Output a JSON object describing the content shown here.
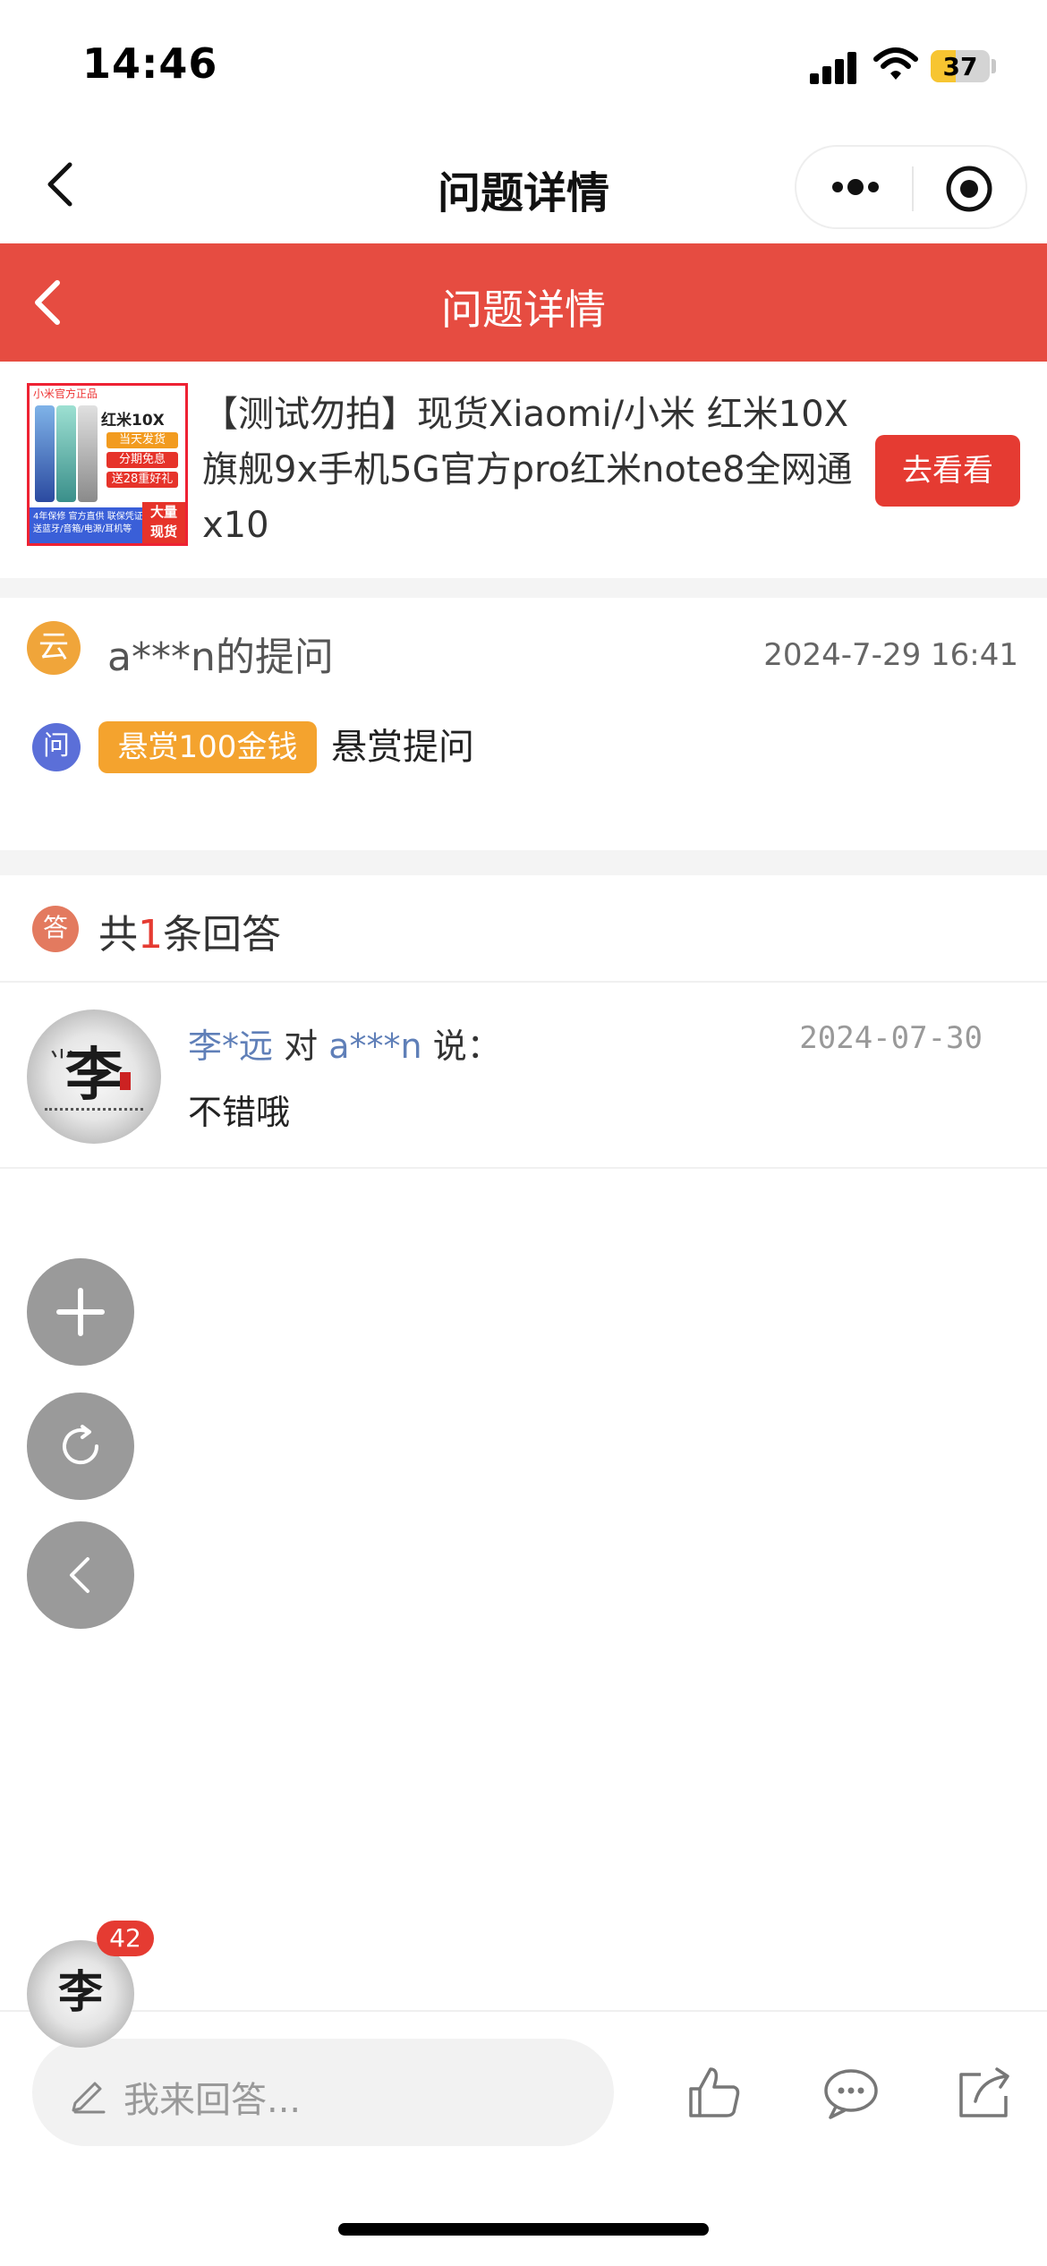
{
  "status_bar": {
    "time": "14:46",
    "battery": "37"
  },
  "nav": {
    "title": "问题详情"
  },
  "header": {
    "title": "问题详情"
  },
  "product": {
    "title": "【测试勿拍】现货Xiaomi/小米 红米10X旗舰9x手机5G官方pro红米note8全网通x10",
    "button": "去看看",
    "thumb": {
      "brand": "小米官方正品",
      "model": "红米10X",
      "tags": [
        "当天发货",
        "分期免息",
        "送28重好礼"
      ],
      "footer1": "4年保修 官方直供 联保凭证",
      "footer2": "送蓝牙/音箱/电源/耳机等",
      "big": [
        "大量",
        "现货"
      ]
    }
  },
  "question": {
    "yun_icon": "云",
    "asker": "a***n的提问",
    "time": "2024-7-29 16:41",
    "wen_icon": "问",
    "reward": "悬赏100金钱",
    "text": "悬赏提问"
  },
  "answers": {
    "da_icon": "答",
    "prefix": "共",
    "count": "1",
    "suffix": "条回答",
    "items": [
      {
        "avatar_char": "李",
        "user": "李*远",
        "mid": "对",
        "target": "a***n",
        "say": "说：",
        "date": "2024-07-30",
        "text": "不错哦"
      }
    ]
  },
  "floating": {
    "badge": "42",
    "avatar_char": "李"
  },
  "bottom": {
    "placeholder": "我来回答..."
  },
  "icons": [
    "back-icon",
    "more-icon",
    "target-icon",
    "plus-icon",
    "refresh-icon",
    "chevron-left-icon",
    "pen-icon",
    "thumbs-up-icon",
    "comment-icon",
    "share-icon"
  ],
  "colors": {
    "accent": "#e64c41",
    "reward": "#f4a32e",
    "link": "#5f7fb8"
  }
}
